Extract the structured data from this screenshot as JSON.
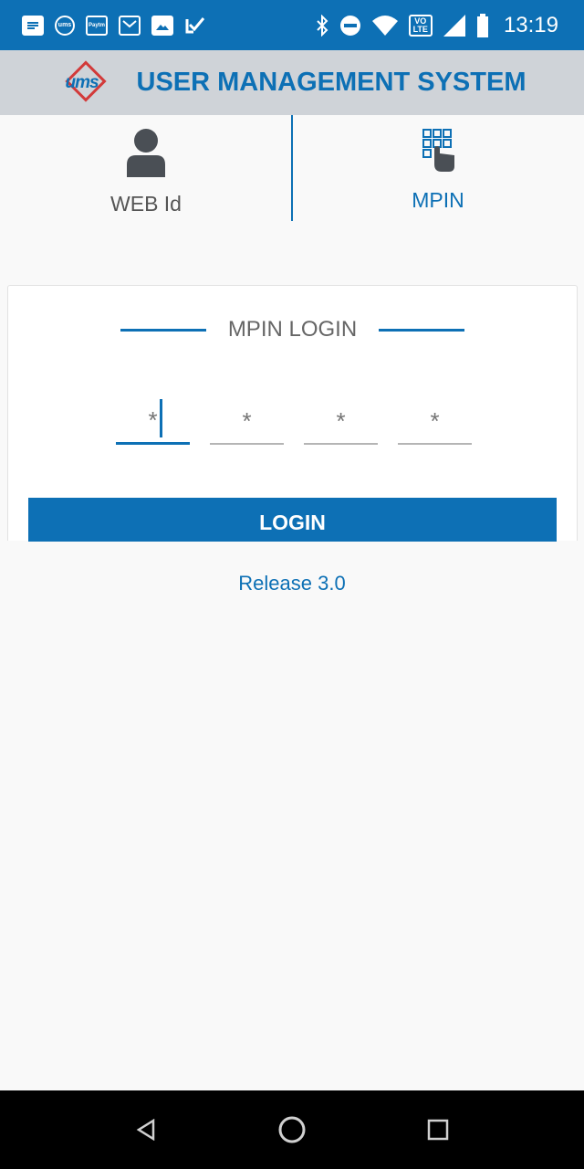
{
  "status_bar": {
    "time": "13:19",
    "paytm_label": "Paytm",
    "ums_label": "ums",
    "volte_top": "VO",
    "volte_bottom": "LTE",
    "left_icons": [
      "message-icon",
      "ums-icon",
      "paytm-icon",
      "gmail-icon",
      "gallery-icon",
      "check-icon"
    ],
    "right_icons": [
      "bluetooth-icon",
      "dnd-icon",
      "wifi-icon",
      "volte-icon",
      "signal-icon",
      "battery-icon"
    ]
  },
  "app_bar": {
    "logo_text": "ums",
    "title": "USER MANAGEMENT SYSTEM"
  },
  "tabs": [
    {
      "label": "WEB Id",
      "icon": "user-icon",
      "active": false
    },
    {
      "label": "MPIN",
      "icon": "keypad-icon",
      "active": true
    }
  ],
  "login_card": {
    "title": "MPIN LOGIN",
    "pin_placeholder": "*",
    "pin_values": [
      "",
      "",
      "",
      ""
    ],
    "login_label": "LOGIN"
  },
  "release": "Release 3.0",
  "colors": {
    "primary": "#0d70b5",
    "app_bar_bg": "#cfd3d8",
    "logo_red": "#d23a3a"
  }
}
